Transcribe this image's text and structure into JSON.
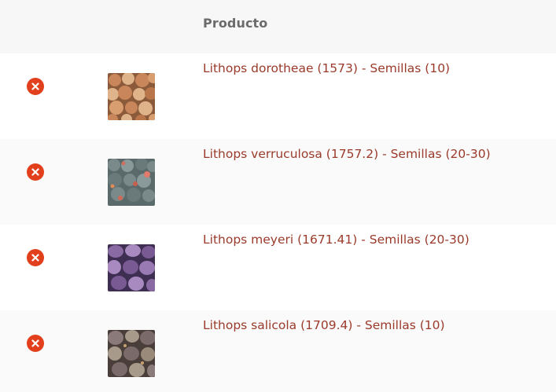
{
  "table": {
    "header": {
      "product_label": "Producto"
    },
    "items": [
      {
        "name": "Lithops dorotheae (1573) - Semillas (10)",
        "remove_icon": "remove-x-circle-icon",
        "thumb_colors": [
          "#c9865a",
          "#e0b48a",
          "#8a5a3a"
        ]
      },
      {
        "name": "Lithops verruculosa (1757.2) - Semillas (20-30)",
        "remove_icon": "remove-x-circle-icon",
        "thumb_colors": [
          "#7a8a8a",
          "#b76a6a",
          "#5a6a6a"
        ]
      },
      {
        "name": "Lithops meyeri (1671.41) - Semillas (20-30)",
        "remove_icon": "remove-x-circle-icon",
        "thumb_colors": [
          "#7a5a92",
          "#a88ac0",
          "#3e2e52"
        ]
      },
      {
        "name": "Lithops salicola (1709.4) - Semillas (10)",
        "remove_icon": "remove-x-circle-icon",
        "thumb_colors": [
          "#7a6a6a",
          "#a89a8a",
          "#4a3e3a"
        ]
      }
    ]
  },
  "colors": {
    "remove": "#e2401c",
    "link": "#9a3a2a",
    "header_bg": "#f7f7f7",
    "header_text": "#6b6b6b"
  }
}
